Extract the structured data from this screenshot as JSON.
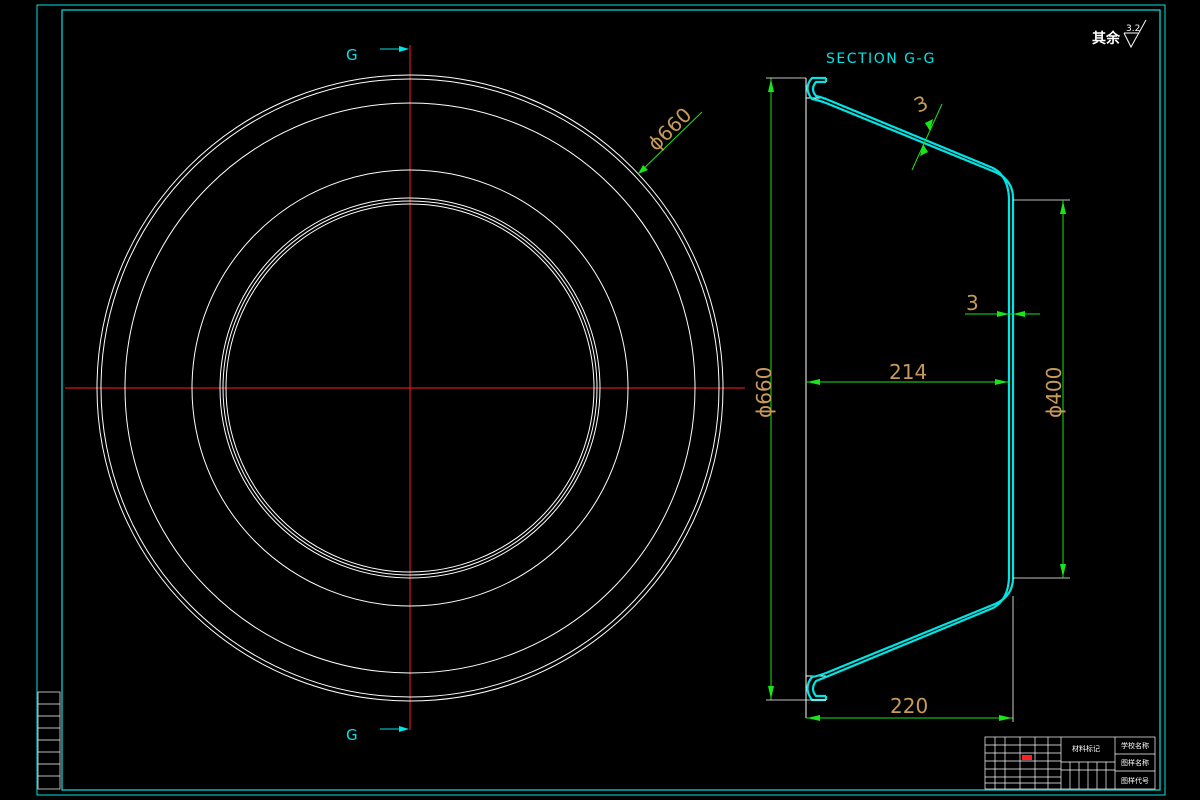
{
  "section": {
    "marker": "G",
    "title": "SECTION G-G"
  },
  "surface_finish": {
    "prefix": "其余",
    "value": "3.2"
  },
  "dimensions": {
    "outer_diameter_plan": "ϕ660",
    "outer_diameter_section": "ϕ660",
    "wall_thickness_slope": "3",
    "wall_thickness_bottom": "3",
    "depth_inner": "214",
    "depth_overall": "220",
    "bottom_diameter": "ϕ400"
  },
  "title_block": {
    "material_mark": "材料标记",
    "school_name": "学校名称",
    "drawing_name": "图样名称",
    "drawing_code": "图样代号"
  },
  "colors": {
    "frame": "#00e5e5",
    "centerline": "#ff2020",
    "geometry": "#ffffff",
    "section_profile": "#00e5e5",
    "dimension_line": "#19e619",
    "dimension_text": "#c89a5a"
  }
}
